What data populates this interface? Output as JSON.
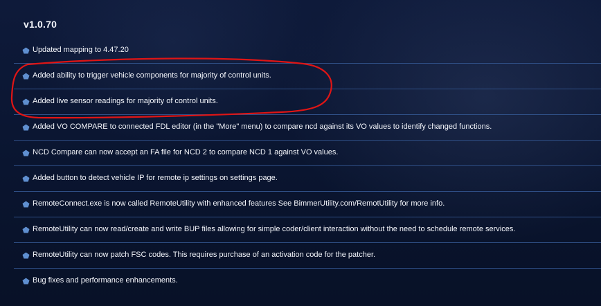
{
  "release": {
    "version": "v1.0.70"
  },
  "changes": [
    "Updated mapping to 4.47.20",
    "Added ability to trigger vehicle components for majority of control units.",
    "Added live sensor readings for majority of control units.",
    "Added VO COMPARE to connected FDL editor (in the \"More\" menu) to compare ncd against its VO values to identify changed functions.",
    "NCD Compare can now accept an FA file for NCD 2 to compare NCD 1 against VO values.",
    "Added button to detect vehicle IP for remote ip settings on settings page.",
    "RemoteConnect.exe is now called RemoteUtility with enhanced features See BimmerUtility.com/RemotUtility for more info.",
    "RemoteUtility can now read/create and write BUP files allowing for simple coder/client interaction without the need to schedule remote services.",
    "RemoteUtility can now patch FSC codes. This requires purchase of an activation code for the patcher.",
    "Bug fixes and performance enhancements."
  ],
  "style": {
    "bullet_color": "#5f8fd0",
    "divider_color": "#2f4f86",
    "highlight_color": "#e01515"
  },
  "icons": {
    "bullet": "pentagon-bullet-icon"
  }
}
